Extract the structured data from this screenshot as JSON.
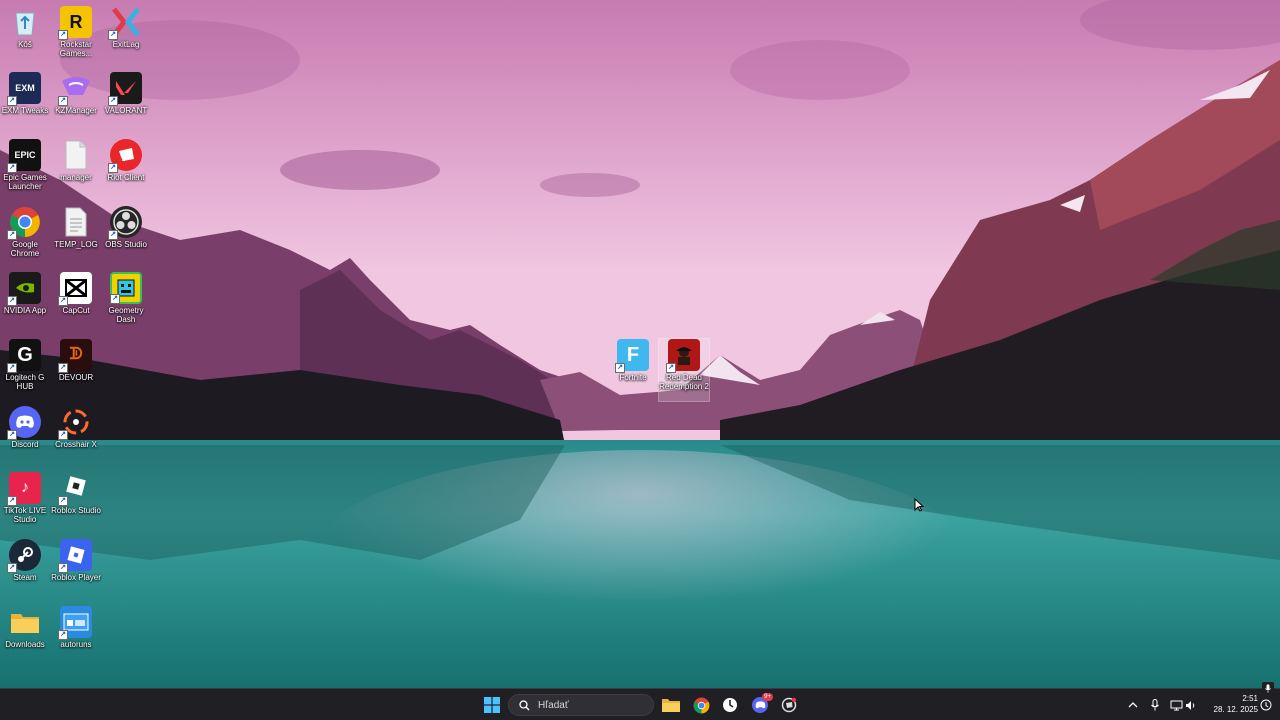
{
  "desktop": {
    "icons": [
      {
        "label": "Kôš"
      },
      {
        "label": "Rockstar Games..."
      },
      {
        "label": "ExitLag"
      },
      {
        "label": "EXM Tweaks"
      },
      {
        "label": "KZManager"
      },
      {
        "label": "VALORANT"
      },
      {
        "label": "Epic Games Launcher"
      },
      {
        "label": "manager"
      },
      {
        "label": "Riot Client"
      },
      {
        "label": "Google Chrome"
      },
      {
        "label": "TEMP_LOG"
      },
      {
        "label": "OBS Studio"
      },
      {
        "label": "NVIDIA App"
      },
      {
        "label": "CapCut"
      },
      {
        "label": "Geometry Dash"
      },
      {
        "label": "Logitech G HUB"
      },
      {
        "label": "DEVOUR"
      },
      {
        "label": "Discord"
      },
      {
        "label": "Crosshair X"
      },
      {
        "label": "TikTok LIVE Studio"
      },
      {
        "label": "Roblox Studio"
      },
      {
        "label": "Steam"
      },
      {
        "label": "Roblox Player"
      },
      {
        "label": "Downloads"
      },
      {
        "label": "autoruns"
      },
      {
        "label": "Fortnite"
      },
      {
        "label": "Red Dead Redemption 2"
      }
    ]
  },
  "taskbar": {
    "search_placeholder": "Hľadať",
    "time": "2:51",
    "date": "28. 12. 2025",
    "discord_badge": "9+"
  }
}
